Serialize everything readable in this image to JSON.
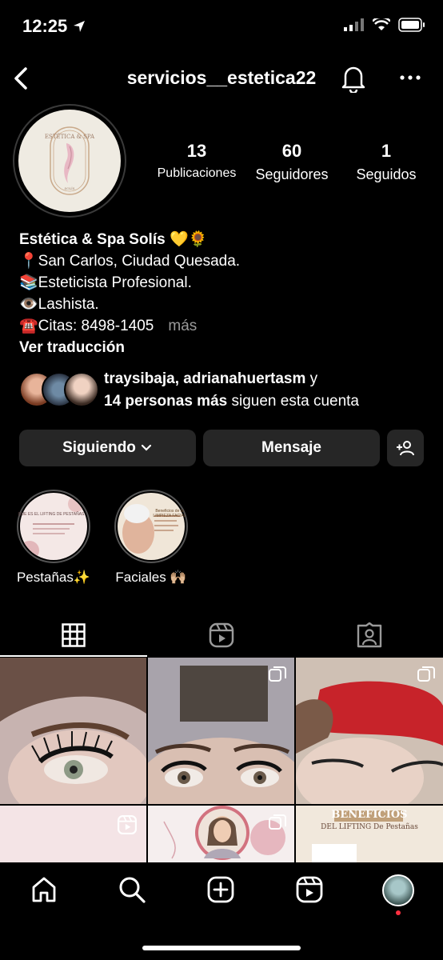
{
  "status": {
    "time": "12:25"
  },
  "header": {
    "username": "servicios__estetica22"
  },
  "profile": {
    "avatar_text": "ESTÉTICA & SPA SOLÍS",
    "stats": [
      {
        "value": "13",
        "label": "Publicaciones"
      },
      {
        "value": "60",
        "label": "Seguidores"
      },
      {
        "value": "1",
        "label": "Seguidos"
      }
    ]
  },
  "bio": {
    "name": "Estética & Spa Solís 💛🌻",
    "lines": [
      "📍San Carlos, Ciudad Quesada.",
      "📚Esteticista Profesional.",
      "👁️Lashista."
    ],
    "phone_line": "☎️Citas: 8498-1405",
    "more": "más",
    "translate": "Ver traducción"
  },
  "followed_by": {
    "names": "traysibaja, adrianahuertasm",
    "conj": " y",
    "count": "14 personas más",
    "suffix": " siguen esta cuenta"
  },
  "actions": {
    "following": "Siguiendo",
    "message": "Mensaje"
  },
  "highlights": [
    {
      "label": "Pestañas✨",
      "cover_text": "QUE ES EL LIFTING DE PESTAÑAS"
    },
    {
      "label": "Faciales 🙌🏼",
      "cover_text": "Beneficios de la LIMPIEZA FACIAL"
    }
  ],
  "posts": {
    "row2_third_title": "BENEFICIOS",
    "row2_third_sub": "DEL LIFTING De Pestañas"
  },
  "colors": {
    "accent_red": "#ff3040",
    "button_bg": "#262626"
  }
}
